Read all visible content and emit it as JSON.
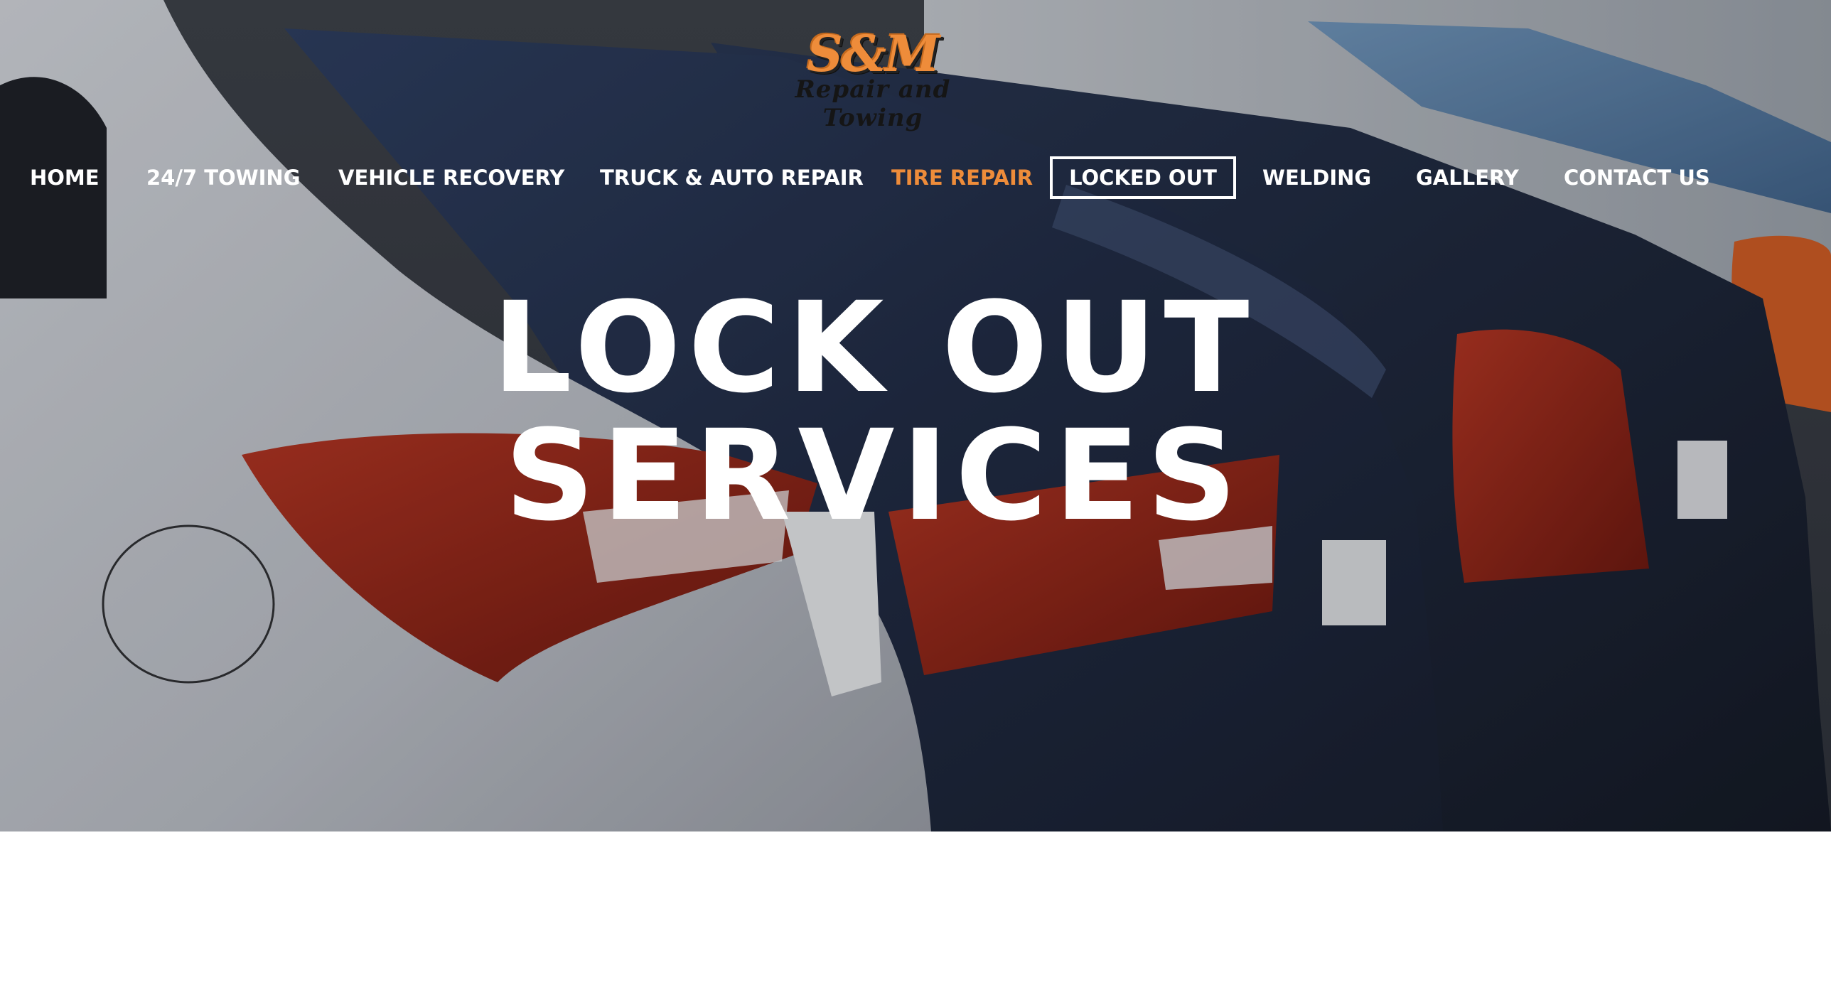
{
  "logo": {
    "mark": "S&M",
    "subtitle": "Repair and Towing"
  },
  "nav": {
    "items": [
      {
        "label": "HOME"
      },
      {
        "label": "24/7 TOWING"
      },
      {
        "label": "VEHICLE RECOVERY"
      },
      {
        "label": "TRUCK & AUTO REPAIR"
      },
      {
        "label": "TIRE REPAIR"
      },
      {
        "label": "LOCKED OUT"
      },
      {
        "label": "WELDING"
      },
      {
        "label": "GALLERY"
      },
      {
        "label": "CONTACT US"
      }
    ],
    "active_label": "LOCKED OUT",
    "hovered_label": "TIRE REPAIR"
  },
  "hero": {
    "title_line1": "LOCK OUT",
    "title_line2": "SERVICES"
  },
  "colors": {
    "accent": "#ee8c3a",
    "nav_text": "#ffffff",
    "page_background": "#ffffff"
  }
}
